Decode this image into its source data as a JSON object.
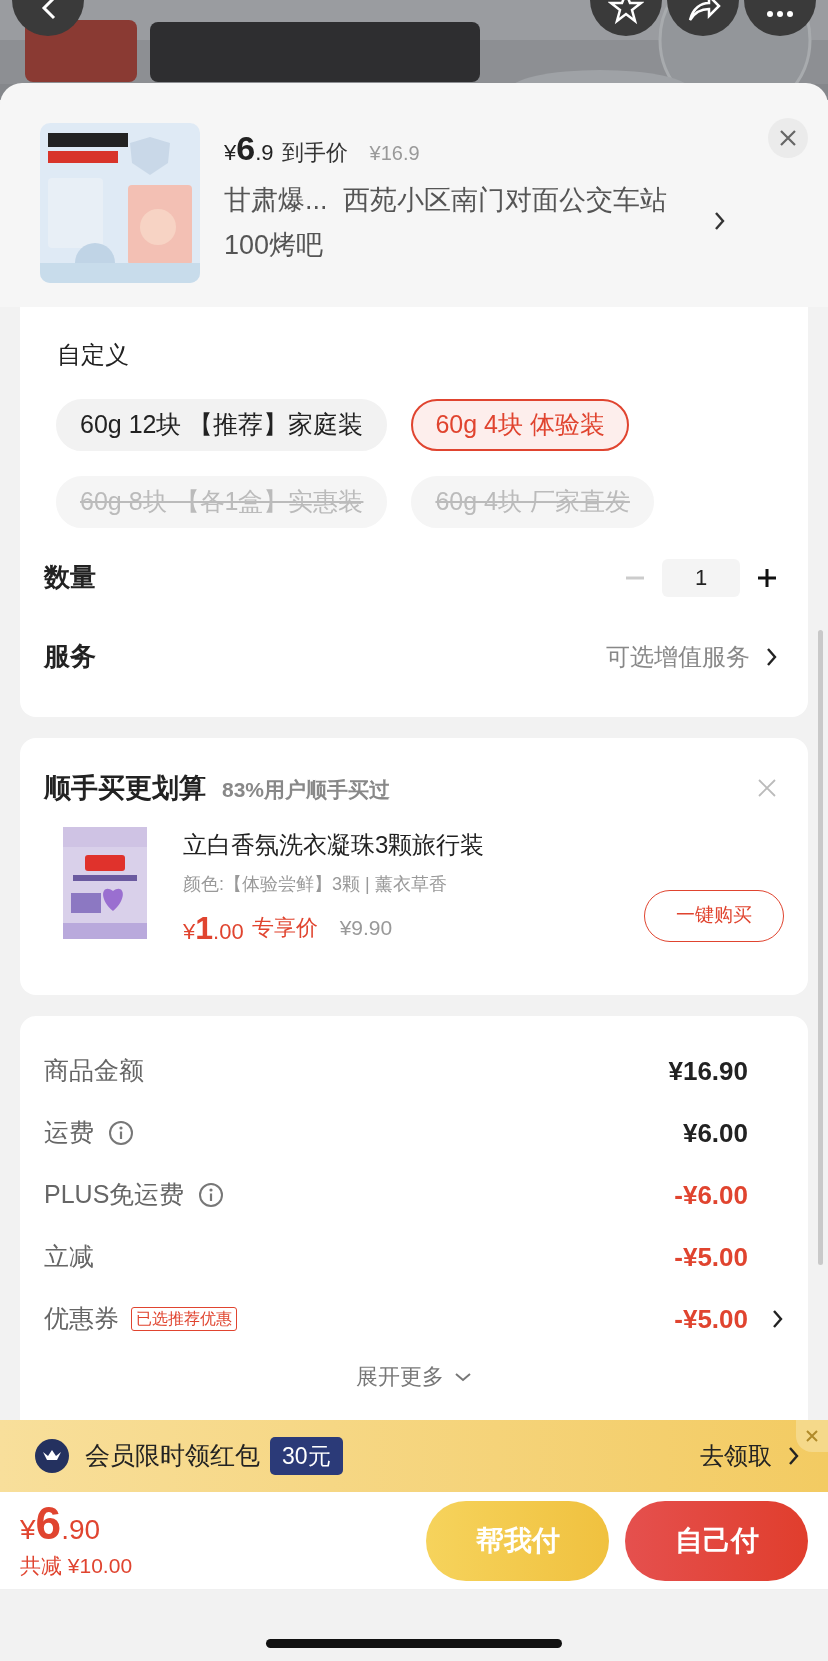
{
  "top_bar": {
    "buttons": [
      {
        "kind": "back"
      },
      {
        "kind": "star"
      },
      {
        "kind": "share"
      },
      {
        "kind": "more"
      }
    ]
  },
  "header": {
    "price": {
      "symbol": "¥",
      "integer": "6",
      "decimal": ".9"
    },
    "price_label": "到手价",
    "original_price": "¥16.9",
    "address": "甘肃爆...  西苑小区南门对面公交车站100烤吧"
  },
  "spec": {
    "title": "自定义",
    "options": [
      {
        "label": "60g 12块 【推荐】家庭装",
        "selected": false,
        "disabled": false
      },
      {
        "label": "60g 4块 体验装",
        "selected": true,
        "disabled": false
      },
      {
        "label": "60g 8块 【各1盒】实惠装",
        "selected": false,
        "disabled": true
      },
      {
        "label": "60g 4块 厂家直发",
        "selected": false,
        "disabled": true
      }
    ]
  },
  "quantity": {
    "label": "数量",
    "value": "1",
    "minus_disabled": true
  },
  "service": {
    "label": "服务",
    "value": "可选增值服务"
  },
  "addon": {
    "title": "顺手买更划算",
    "subtitle": "83%用户顺手买过",
    "product": {
      "name": "立白香氛洗衣凝珠3颗旅行装",
      "spec": "颜色:【体验尝鲜】3颗 | 薰衣草香",
      "price": {
        "symbol": "¥",
        "integer": "1",
        "decimal": ".00"
      },
      "price_label": "专享价",
      "original_price": "¥9.90",
      "button": "一键购买"
    }
  },
  "summary": {
    "rows": [
      {
        "label": "商品金额",
        "info": false,
        "amount": "¥16.90",
        "discount": false,
        "link": false
      },
      {
        "label": "运费",
        "info": true,
        "amount": "¥6.00",
        "discount": false,
        "link": false
      },
      {
        "label": "PLUS免运费",
        "info": true,
        "amount": "-¥6.00",
        "discount": true,
        "link": false
      },
      {
        "label": "立减",
        "info": false,
        "amount": "-¥5.00",
        "discount": true,
        "link": false
      },
      {
        "label": "优惠券",
        "info": false,
        "tag": "已选推荐优惠",
        "amount": "-¥5.00",
        "discount": true,
        "link": true
      }
    ],
    "expand": "展开更多"
  },
  "promo": {
    "text": "会员限时领红包",
    "badge": "30元",
    "action": "去领取"
  },
  "footer": {
    "price": {
      "symbol": "¥",
      "integer": "6",
      "decimal": ".90"
    },
    "saved": "共减 ¥10.00",
    "buttons": [
      {
        "label": "帮我付",
        "kind": "secondary"
      },
      {
        "label": "自己付",
        "kind": "primary"
      }
    ]
  }
}
